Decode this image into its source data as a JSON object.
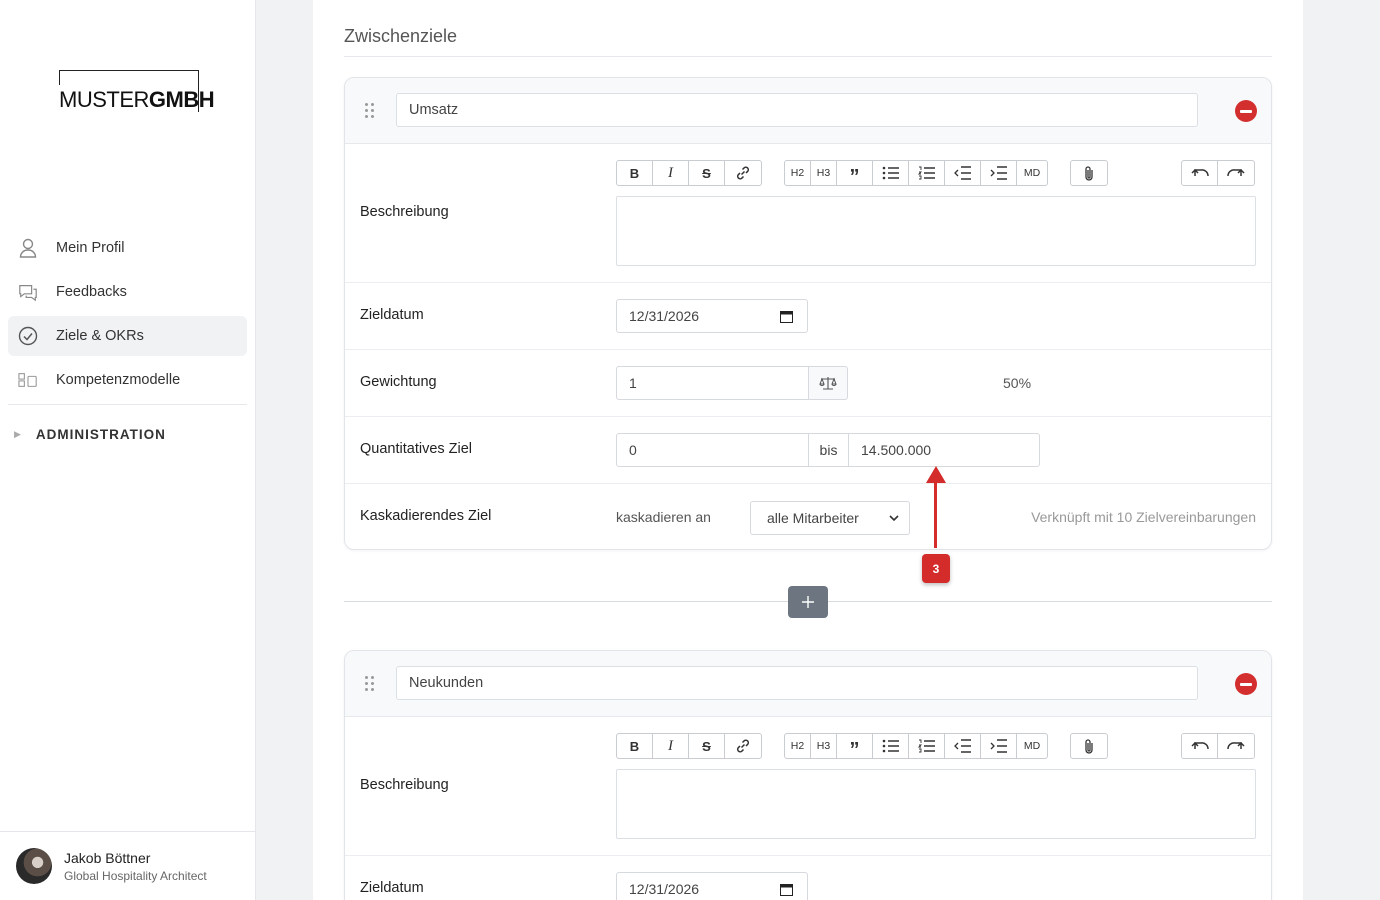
{
  "logo": {
    "part1": "MUSTER",
    "part2": "GMBH"
  },
  "nav": {
    "items": [
      {
        "label": "Mein Profil",
        "icon": "user-icon"
      },
      {
        "label": "Feedbacks",
        "icon": "chat-icon"
      },
      {
        "label": "Ziele & OKRs",
        "icon": "check-circle-icon",
        "active": true
      },
      {
        "label": "Kompetenzmodelle",
        "icon": "blocks-icon"
      }
    ],
    "admin_label": "ADMINISTRATION"
  },
  "user": {
    "name": "Jakob Böttner",
    "role": "Global Hospitality Architect"
  },
  "section": {
    "title": "Zwischenziele"
  },
  "toolbar": {
    "h2": "H2",
    "h3": "H3",
    "md": "MD"
  },
  "labels": {
    "beschreibung": "Beschreibung",
    "zieldatum": "Zieldatum",
    "gewichtung": "Gewichtung",
    "quantitativ": "Quantitatives Ziel",
    "kaskadierend": "Kaskadierendes Ziel",
    "bis": "bis",
    "kaskadieren_an": "kaskadieren an"
  },
  "goals": [
    {
      "title": "Umsatz",
      "date": "12/31/2026",
      "weight": "1",
      "weight_percent": "50%",
      "from": "0",
      "to": "14.500.000",
      "cascade_target": "alle Mitarbeiter",
      "linked_text": "Verknüpft mit 10 Zielvereinbarungen"
    },
    {
      "title": "Neukunden",
      "date": "12/31/2026"
    }
  ],
  "annotation": {
    "number": "3",
    "color": "#d42b2b"
  },
  "colors": {
    "remove": "#d32f2f",
    "add_button": "#6c7580"
  }
}
